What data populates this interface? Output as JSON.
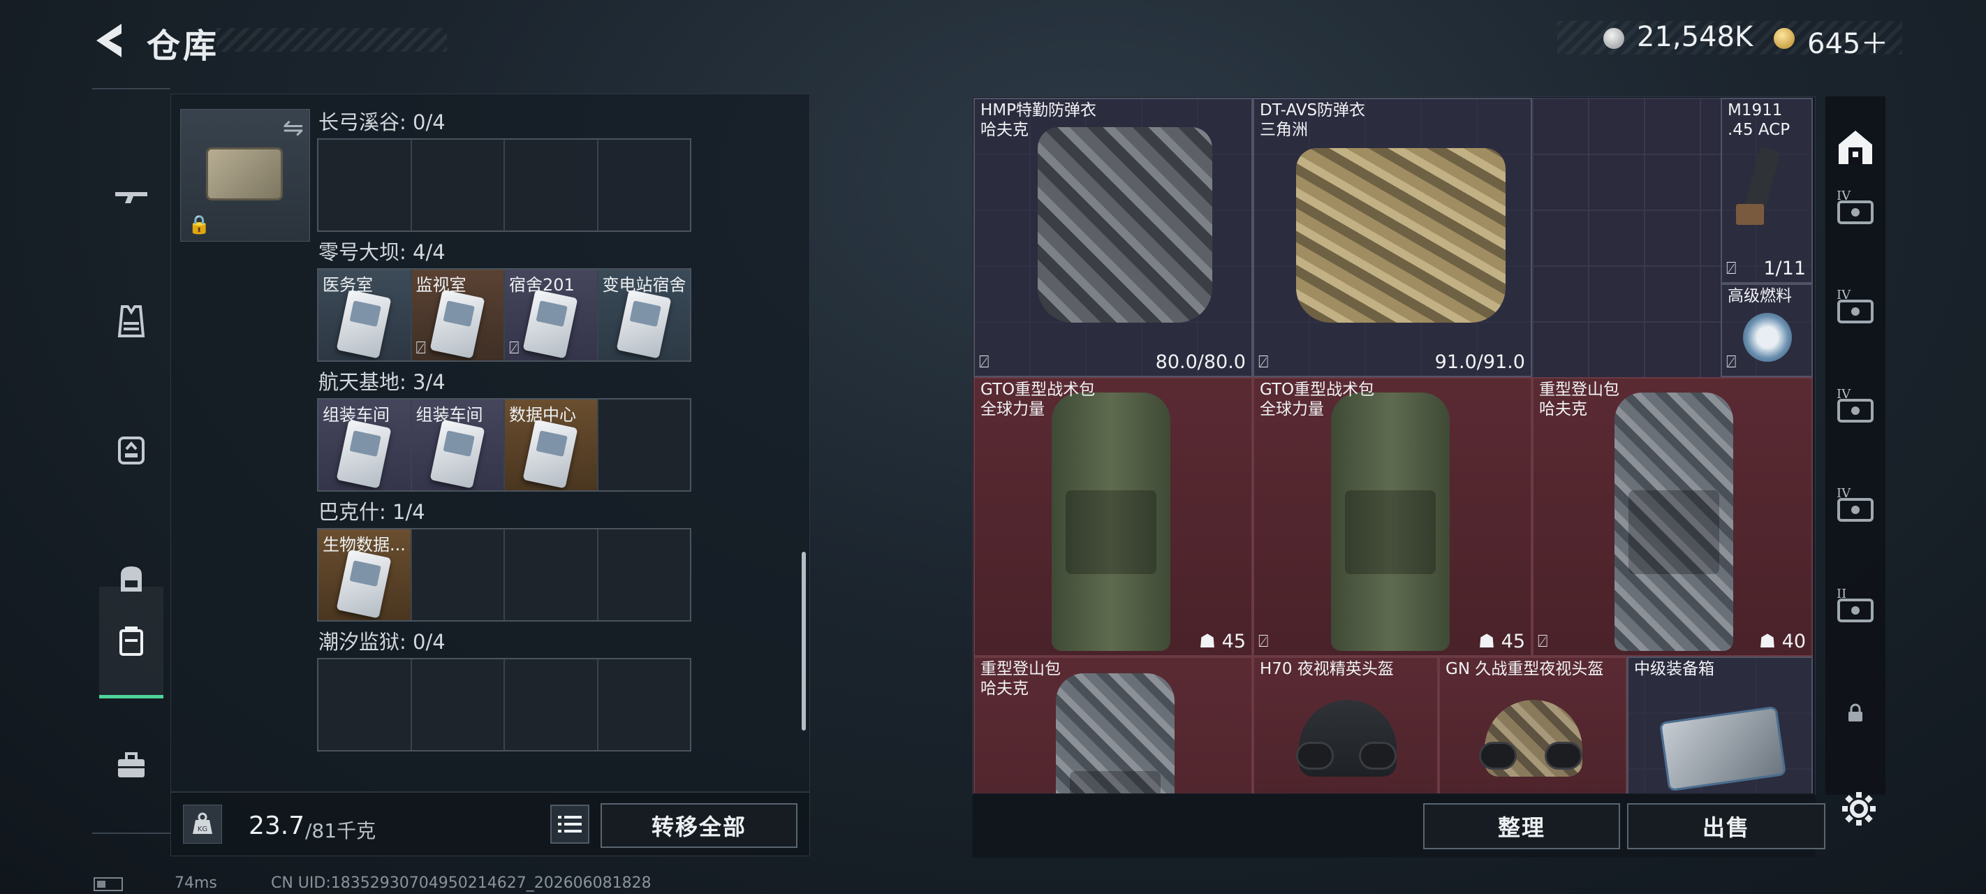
{
  "header": {
    "title": "仓库",
    "back_icon": "back-arrow-icon"
  },
  "currency": {
    "silver": "21,548K",
    "gold": "645＋",
    "silver_icon": "silver-coin-icon",
    "gold_icon": "gold-coin-icon"
  },
  "sidenav": {
    "items": [
      {
        "name": "weapons",
        "icon": "rifle-icon"
      },
      {
        "name": "armor",
        "icon": "vest-icon"
      },
      {
        "name": "chest-rig",
        "icon": "rig-icon"
      },
      {
        "name": "backpack",
        "icon": "backpack-icon"
      },
      {
        "name": "keys",
        "icon": "keycard-case-icon",
        "active": true
      },
      {
        "name": "toolbox",
        "icon": "toolbox-icon"
      }
    ]
  },
  "stash": {
    "groups": [
      {
        "label": "长弓溪谷: 0/4",
        "cells": []
      },
      {
        "label": "零号大坝: 4/4",
        "cells": [
          {
            "name": "医务室",
            "color": "blue",
            "flag": false
          },
          {
            "name": "监视室",
            "color": "brown",
            "flag": true
          },
          {
            "name": "宿舍201",
            "color": "purple",
            "flag": true
          },
          {
            "name": "变电站宿舍",
            "color": "steel",
            "flag": false
          }
        ]
      },
      {
        "label": "航天基地: 3/4",
        "cells": [
          {
            "name": "组装车间",
            "color": "purple",
            "flag": false
          },
          {
            "name": "组装车间",
            "color": "purple",
            "flag": false
          },
          {
            "name": "数据中心",
            "color": "gold",
            "flag": false
          }
        ]
      },
      {
        "label": "巴克什: 1/4",
        "cells": [
          {
            "name": "生物数据...",
            "color": "gold",
            "flag": false
          }
        ]
      },
      {
        "label": "潮汐监狱: 0/4",
        "cells": []
      }
    ],
    "weight": {
      "current": "23.7",
      "max": "/81千克",
      "icon": "kg-weight-icon"
    },
    "transfer_all": "转移全部"
  },
  "inventory": {
    "items": [
      {
        "name": "HMP特勤防弹衣\n哈夫克",
        "value": "80.0/80.0"
      },
      {
        "name": "DT-AVS防弹衣\n三角洲",
        "value": "91.0/91.0"
      },
      {
        "name": "M1911\n.45 ACP",
        "value": "1/11"
      },
      {
        "name": "高级燃料",
        "value": ""
      },
      {
        "name": "GTO重型战术包\n全球力量",
        "value": "45"
      },
      {
        "name": "GTO重型战术包\n全球力量",
        "value": "45"
      },
      {
        "name": "重型登山包\n哈夫克",
        "value": "40"
      },
      {
        "name": "重型登山包\n哈夫克",
        "value": ""
      },
      {
        "name": "H70 夜视精英头盔",
        "value": ""
      },
      {
        "name": "GN 久战重型夜视头盔",
        "value": ""
      },
      {
        "name": "中级装备箱",
        "value": ""
      }
    ],
    "sort": "整理",
    "sell": "出售"
  },
  "rtabs": [
    {
      "icon": "home-stash-icon",
      "tier": ""
    },
    {
      "icon": "case-icon",
      "tier": "IV"
    },
    {
      "icon": "case-icon",
      "tier": "IV"
    },
    {
      "icon": "case-icon",
      "tier": "IV"
    },
    {
      "icon": "case-icon",
      "tier": "IV"
    },
    {
      "icon": "case-icon",
      "tier": "II"
    },
    {
      "icon": "lock-icon",
      "tier": ""
    }
  ],
  "status": {
    "ping": "74ms",
    "uid": "CN UID:18352930704950214627_202606081828"
  }
}
